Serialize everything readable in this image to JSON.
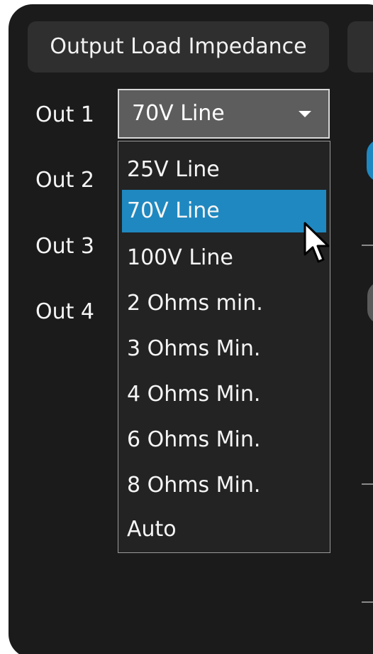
{
  "panel": {
    "header_title": "Output Load Impedance"
  },
  "outputs": [
    {
      "label": "Out 1"
    },
    {
      "label": "Out 2"
    },
    {
      "label": "Out 3"
    },
    {
      "label": "Out 4"
    }
  ],
  "combo": {
    "selected_value": "70V Line"
  },
  "dropdown": {
    "options": [
      {
        "label": "25V Line"
      },
      {
        "label": "70V Line"
      },
      {
        "label": "100V Line"
      },
      {
        "label": "2 Ohms min."
      },
      {
        "label": "3 Ohms Min."
      },
      {
        "label": "4 Ohms Min."
      },
      {
        "label": "6 Ohms Min."
      },
      {
        "label": "8 Ohms Min."
      },
      {
        "label": "Auto"
      }
    ],
    "highlighted_index": 1
  },
  "colors": {
    "accent": "#1f88c0",
    "panel_bg": "#1b1b1b"
  },
  "icons": {
    "cursor": "arrow-cursor-icon",
    "dropdown_caret": "caret-down-icon"
  }
}
